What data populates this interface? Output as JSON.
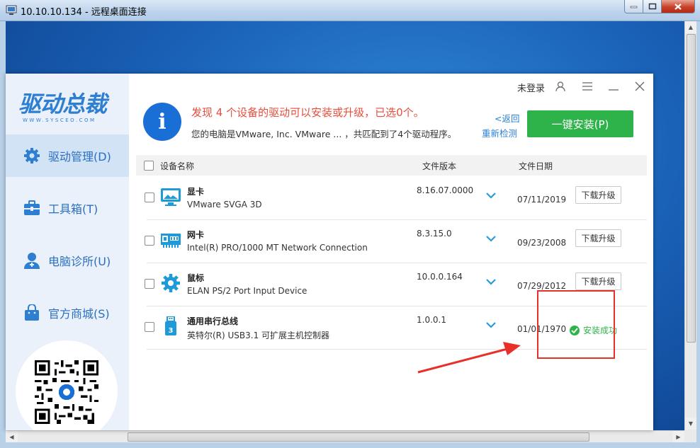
{
  "rdp": {
    "title": "10.10.10.134 - 远程桌面连接",
    "min_label": "—",
    "max_label": "□",
    "close_label": "✕"
  },
  "app": {
    "logo_text": "驱动总裁",
    "logo_sub": "WWW.SYSCEO.COM",
    "topbar": {
      "login_label": "未登录"
    },
    "sidebar": [
      {
        "label": "驱动管理(D)",
        "icon": "gear-icon"
      },
      {
        "label": "工具箱(T)",
        "icon": "toolbox-icon"
      },
      {
        "label": "电脑诊所(U)",
        "icon": "doctor-icon"
      },
      {
        "label": "官方商城(S)",
        "icon": "shop-bag-icon"
      }
    ],
    "notice": {
      "title": "发现 4 个设备的驱动可以安装或升级，已选0个。",
      "subtitle": "您的电脑是VMware, Inc. VMware ... ，共匹配到了4个驱动程序。",
      "back_label": "<返回",
      "recheck_label": "重新检测",
      "install_label": "一键安装(P)"
    },
    "table": {
      "headers": {
        "name": "设备名称",
        "version": "文件版本",
        "date": "文件日期"
      },
      "rows": [
        {
          "name": "显卡",
          "model": "VMware SVGA 3D",
          "version": "8.16.07.0000",
          "date": "07/11/2019",
          "action": "下载升级",
          "icon": "display-icon"
        },
        {
          "name": "网卡",
          "model": "Intel(R) PRO/1000 MT Network Connection",
          "version": "8.3.15.0",
          "date": "09/23/2008",
          "action": "下载升级",
          "icon": "network-card-icon"
        },
        {
          "name": "鼠标",
          "model": "ELAN PS/2 Port Input Device",
          "version": "10.0.0.164",
          "date": "07/29/2012",
          "action": "下载升级",
          "icon": "gear-device-icon"
        },
        {
          "name": "通用串行总线",
          "model": "英特尔(R) USB3.1 可扩展主机控制器",
          "version": "1.0.0.1",
          "date": "01/01/1970",
          "action": "安装成功",
          "icon": "usb-drive-icon"
        }
      ]
    }
  },
  "colors": {
    "accent": "#2a7fd6",
    "alert": "#e84d3c",
    "success": "#2db34a",
    "annotation": "#e8302b"
  }
}
